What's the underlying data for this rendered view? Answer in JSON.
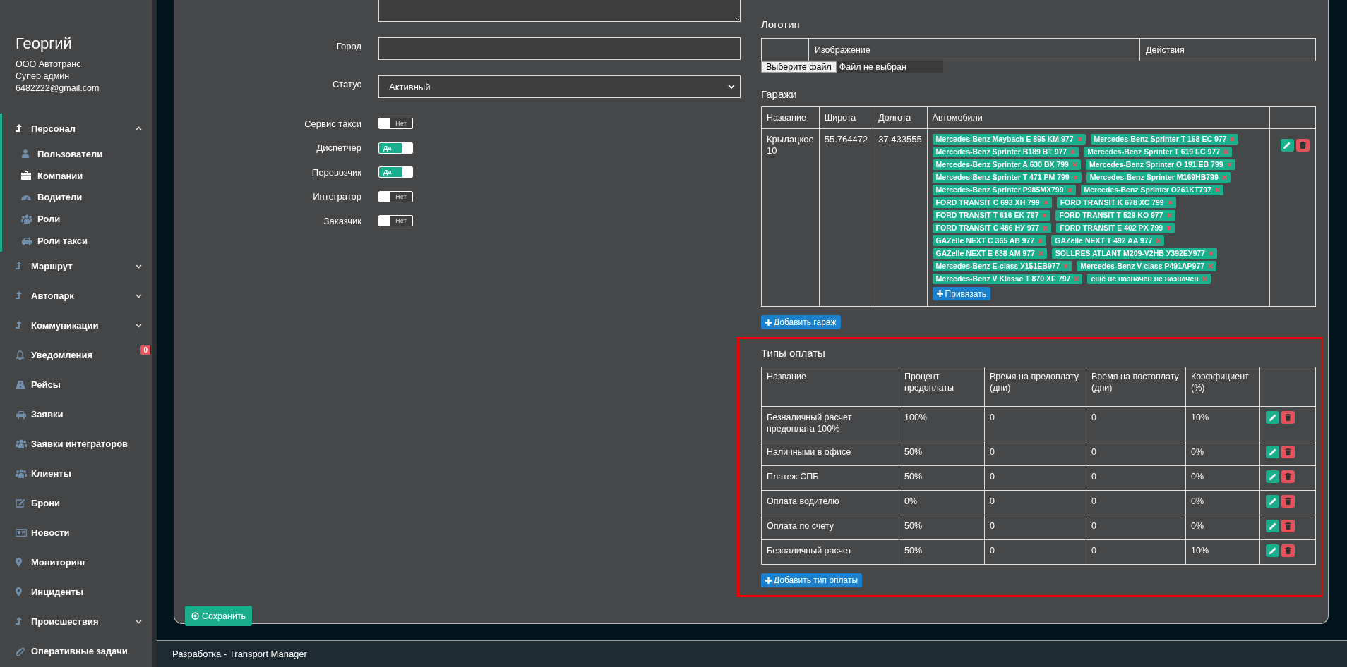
{
  "user": {
    "name": "Георгий",
    "company": "ООО Автотранс",
    "role": "Супер админ",
    "email": "6482222@gmail.com"
  },
  "sidebar": {
    "items": [
      {
        "label": "Персонал",
        "expanded": true,
        "children": [
          {
            "label": "Пользователи"
          },
          {
            "label": "Компании"
          },
          {
            "label": "Водители"
          },
          {
            "label": "Роли"
          },
          {
            "label": "Роли такси"
          }
        ]
      },
      {
        "label": "Маршрут",
        "expanded": false
      },
      {
        "label": "Автопарк",
        "expanded": false
      },
      {
        "label": "Коммуникации",
        "expanded": false
      },
      {
        "label": "Уведомления",
        "badge": "0"
      },
      {
        "label": "Рейсы"
      },
      {
        "label": "Заявки"
      },
      {
        "label": "Заявки интеграторов"
      },
      {
        "label": "Клиенты"
      },
      {
        "label": "Брони"
      },
      {
        "label": "Новости"
      },
      {
        "label": "Мониторинг"
      },
      {
        "label": "Инциденты"
      },
      {
        "label": "Происшествия",
        "expanded": false
      },
      {
        "label": "Оперативные задачи"
      }
    ]
  },
  "form": {
    "fields": [
      {
        "label": "Город",
        "kind": "text"
      },
      {
        "label": "Статус",
        "kind": "select",
        "value": "Активный"
      }
    ],
    "toggles": [
      {
        "label": "Сервис такси",
        "on": false,
        "text": "Нет"
      },
      {
        "label": "Диспетчер",
        "on": true,
        "text": "Да"
      },
      {
        "label": "Перевозчик",
        "on": true,
        "text": "Да"
      },
      {
        "label": "Интегратор",
        "on": false,
        "text": "Нет"
      },
      {
        "label": "Заказчик",
        "on": false,
        "text": "Нет"
      }
    ]
  },
  "logo": {
    "title": "Логотип",
    "columns": [
      "Изображение",
      "Действия"
    ],
    "file_button": "Выберите файл",
    "file_status": "Файл не выбран"
  },
  "garages": {
    "title": "Гаражи",
    "columns": [
      "Название",
      "Широта",
      "Долгота",
      "Автомобили"
    ],
    "rows": [
      {
        "name": "Крылацкое 10",
        "lat": "55.764472",
        "lon": "37.433555",
        "bind_button": "Привязать",
        "cars": [
          "Mercedes-Benz Maybach E 895 KM 977",
          "Mercedes-Benz Sprinter T 168 EC 977",
          "Mercedes-Benz Sprinter B189 BT 977",
          "Mercedes-Benz Sprinter T 619 EC 977",
          "Mercedes-Benz Sprinter A 630 BX 799",
          "Mercedes-Benz Sprinter O 191 EB 799",
          "Mercedes-Benz Sprinter T 471 PM 799",
          "Mercedes-Benz Sprinter M169HB799",
          "Mercedes-Benz Sprinter P985MX799",
          "Mercedes-Benz Sprinter O261KT797",
          "FORD TRANSIT C 693 XH 799",
          "FORD TRANSIT K 678 XC 799",
          "FORD TRANSIT T 616 EK 797",
          "FORD TRANSIT T 529 KO 977",
          "FORD TRANSIT C 486 HУ 977",
          "FORD TRANSIT E 402 PX 799",
          "GAZelle NEXT C 365 AB 977",
          "GAZelle NEXT T 492 AA 977",
          "GAZelle NEXT E 638 AM 977",
          "SOLLRES ATLANT M209-V2HB У392ЕУ977",
          "Mercedes-Benz E-class У151ЕВ977",
          "Mercedes-Benz V-class P491AP977",
          "Mercedes-Benz V Klasse T 870 XE 797",
          "ещё не назначен не назначен"
        ]
      }
    ],
    "add_button": "Добавить гараж"
  },
  "payment_types": {
    "title": "Типы оплаты",
    "columns": [
      "Название",
      "Процент предоплаты",
      "Время на предоплату (дни)",
      "Время на постоплату (дни)",
      "Коэффициент (%)"
    ],
    "rows": [
      [
        "Безналичный расчет предоплата 100%",
        "100%",
        "0",
        "0",
        "10%"
      ],
      [
        "Наличными в офисе",
        "50%",
        "0",
        "0",
        "0%"
      ],
      [
        "Платеж СПБ",
        "50%",
        "0",
        "0",
        "0%"
      ],
      [
        "Оплата водителю",
        "0%",
        "0",
        "0",
        "0%"
      ],
      [
        "Оплата по счету",
        "50%",
        "0",
        "0",
        "0%"
      ],
      [
        "Безналичный расчет",
        "50%",
        "0",
        "0",
        "10%"
      ]
    ],
    "add_button": "Добавить тип оплаты"
  },
  "save_button": "Сохранить",
  "footer": "Разработка - Transport Manager"
}
